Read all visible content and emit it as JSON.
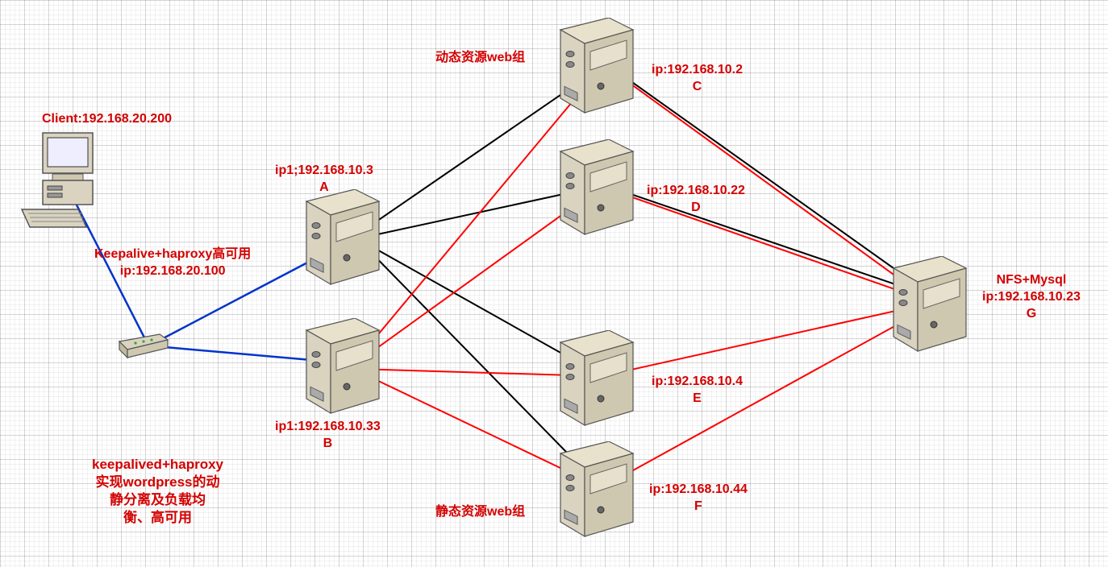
{
  "nodes": {
    "client": {
      "label": "Client:192.168.20.200"
    },
    "switch": {
      "label1": "Keepalive+haproxy高可用",
      "label2": "ip:192.168.20.100"
    },
    "A": {
      "label1": "ip1;192.168.10.3",
      "label2": "A"
    },
    "B": {
      "label1": "ip1:192.168.10.33",
      "label2": "B"
    },
    "C": {
      "label1": "ip:192.168.10.2",
      "label2": "C"
    },
    "D": {
      "label1": "ip:192.168.10.22",
      "label2": "D"
    },
    "E": {
      "label1": "ip:192.168.10.4",
      "label2": "E"
    },
    "F": {
      "label1": "ip:192.168.10.44",
      "label2": "F"
    },
    "G": {
      "label1": "NFS+Mysql",
      "label2": "ip:192.168.10.23",
      "label3": "G"
    },
    "dynamic_group": {
      "label": "动态资源web组"
    },
    "static_group": {
      "label": "静态资源web组"
    }
  },
  "caption": {
    "line1": "keepalived+haproxy",
    "line2": "实现wordpress的动",
    "line3": "静分离及负载均",
    "line4": "衡、高可用"
  },
  "colors": {
    "red": "#d40000",
    "blue": "#0033cc",
    "black": "#000000"
  }
}
